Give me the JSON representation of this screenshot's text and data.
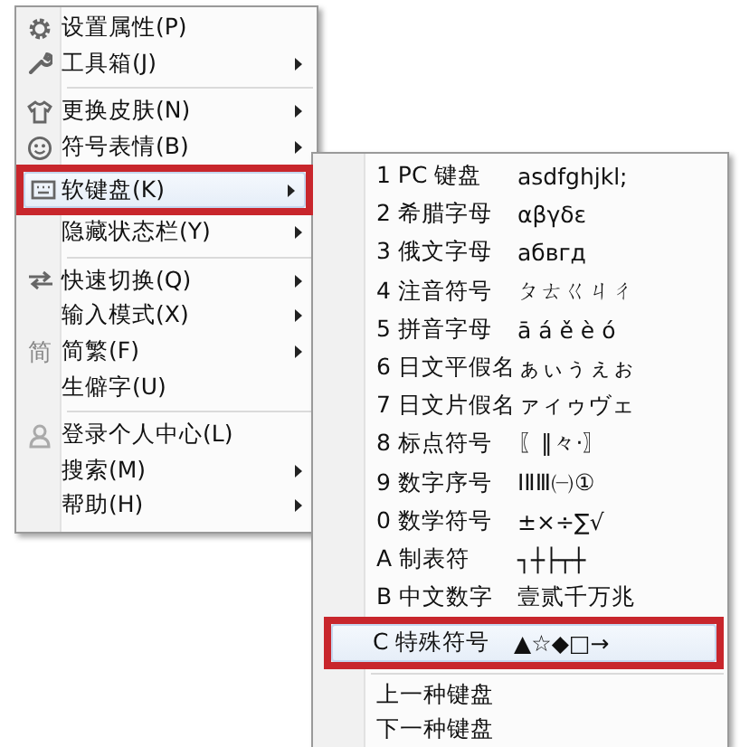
{
  "menu": {
    "groups": [
      [
        {
          "label": "设置属性(P)",
          "submenu": false,
          "selected": false,
          "annotated": false
        },
        {
          "label": "工具箱(J)",
          "submenu": true,
          "selected": false,
          "annotated": false
        }
      ],
      [
        {
          "label": "更换皮肤(N)",
          "submenu": true,
          "selected": false,
          "annotated": false
        },
        {
          "label": "符号表情(B)",
          "submenu": true,
          "selected": false,
          "annotated": false
        },
        {
          "label": "软键盘(K)",
          "submenu": true,
          "selected": true,
          "annotated": true
        },
        {
          "label": "隐藏状态栏(Y)",
          "submenu": true,
          "selected": false,
          "annotated": false
        }
      ],
      [
        {
          "label": "快速切换(Q)",
          "submenu": true,
          "selected": false,
          "annotated": false
        },
        {
          "label": "输入模式(X)",
          "submenu": true,
          "selected": false,
          "annotated": false
        },
        {
          "label": "简繁(F)",
          "icon_text": "简",
          "submenu": true,
          "selected": false,
          "annotated": false
        },
        {
          "label": "生僻字(U)",
          "submenu": false,
          "selected": false,
          "annotated": false
        }
      ],
      [
        {
          "label": "登录个人中心(L)",
          "submenu": false,
          "selected": false,
          "annotated": false
        },
        {
          "label": "搜索(M)",
          "submenu": true,
          "selected": false,
          "annotated": false
        },
        {
          "label": "帮助(H)",
          "submenu": true,
          "selected": false,
          "annotated": false
        }
      ]
    ]
  },
  "soft_keyboard": {
    "items": [
      {
        "label": "1 PC 键盘",
        "sample": "asdfghjkl;",
        "selected": false,
        "annotated": false
      },
      {
        "label": "2 希腊字母",
        "sample": "αβγδε",
        "selected": false,
        "annotated": false
      },
      {
        "label": "3 俄文字母",
        "sample": "абвгд",
        "selected": false,
        "annotated": false
      },
      {
        "label": "4 注音符号",
        "sample": "ㄆㄊㄍㄐㄔ",
        "selected": false,
        "annotated": false
      },
      {
        "label": "5 拼音字母",
        "sample": "ā á ě è ó",
        "selected": false,
        "annotated": false
      },
      {
        "label": "6 日文平假名",
        "sample": "ぁぃぅぇぉ",
        "selected": false,
        "annotated": false
      },
      {
        "label": "7 日文片假名",
        "sample": "ァィゥヴェ",
        "selected": false,
        "annotated": false
      },
      {
        "label": "8 标点符号",
        "sample": "〖‖々·〗",
        "selected": false,
        "annotated": false
      },
      {
        "label": "9 数字序号",
        "sample": "ⅠⅡⅢ㈠①",
        "selected": false,
        "annotated": false
      },
      {
        "label": "0 数学符号",
        "sample": "±×÷∑√",
        "selected": false,
        "annotated": false
      },
      {
        "label": "A 制表符",
        "sample": "┐┼├┬┼",
        "selected": false,
        "annotated": false
      },
      {
        "label": "B 中文数字",
        "sample": "壹贰千万兆",
        "selected": false,
        "annotated": false
      },
      {
        "label": "C 特殊符号",
        "sample": "▲☆◆□→",
        "selected": true,
        "annotated": true
      }
    ],
    "nav": [
      {
        "label": "上一种键盘",
        "selected": false
      },
      {
        "label": "下一种键盘",
        "selected": false
      }
    ]
  }
}
